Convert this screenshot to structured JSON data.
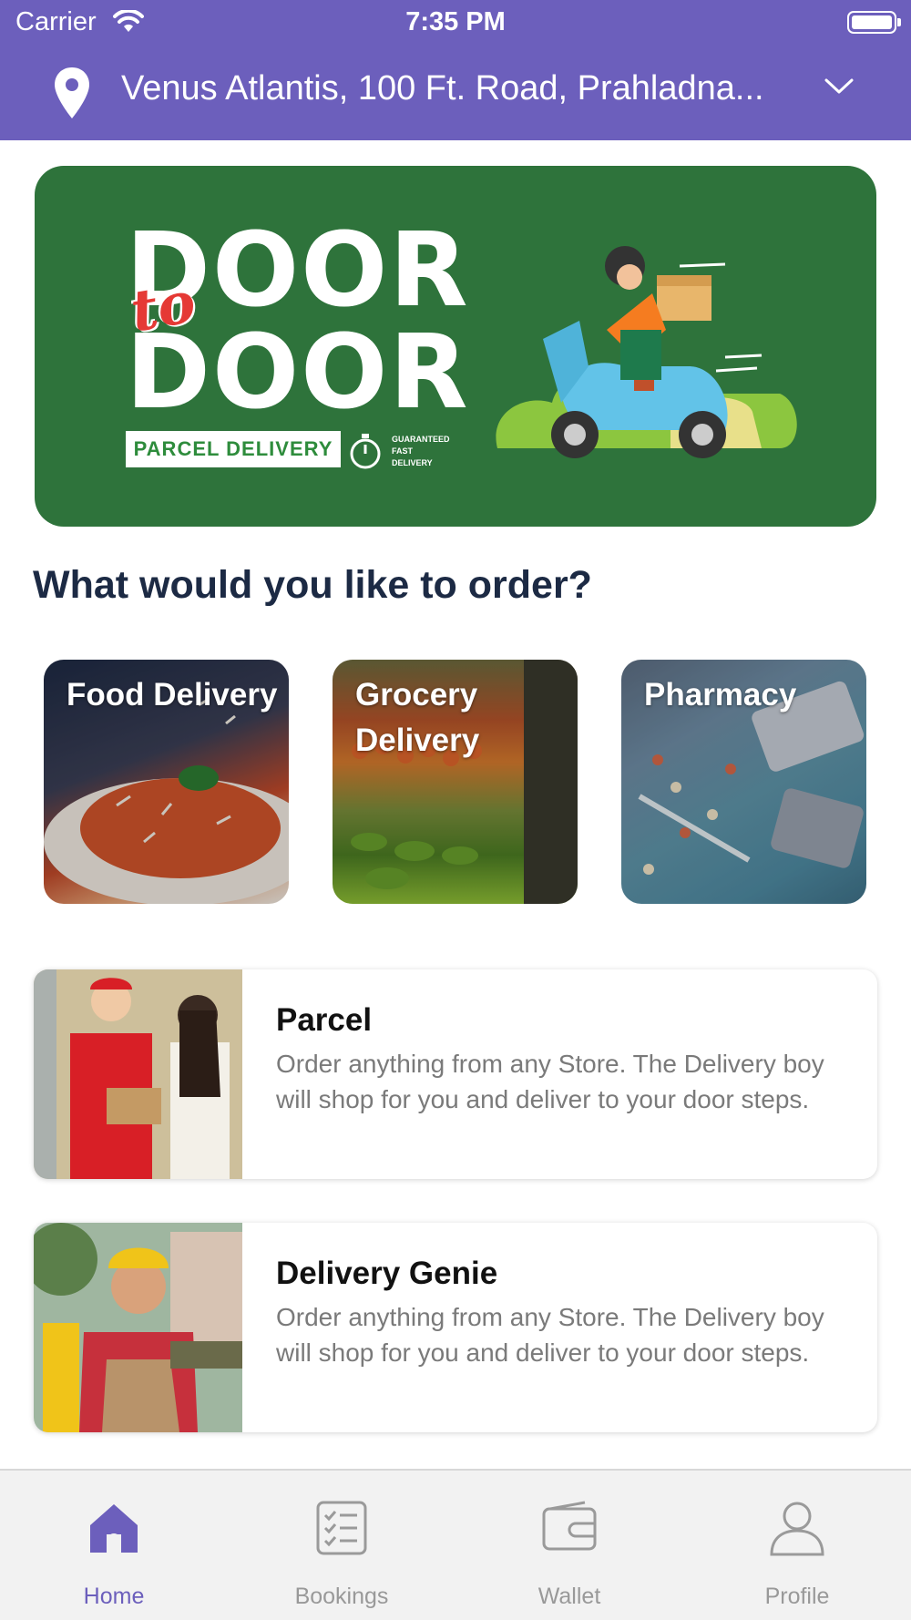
{
  "status_bar": {
    "carrier": "Carrier",
    "time": "7:35 PM"
  },
  "location": {
    "address": "Venus Atlantis, 100 Ft. Road, Prahladna..."
  },
  "banner": {
    "line1": "DOOR",
    "connector": "to",
    "line2": "DOOR",
    "tag": "PARCEL DELIVERY",
    "guarantee_line1": "GUARANTEED",
    "guarantee_line2": "FAST",
    "guarantee_line3": "DELIVERY"
  },
  "section_title": "What would you like to order?",
  "categories": [
    {
      "label": "Food Delivery"
    },
    {
      "label": "Grocery Delivery"
    },
    {
      "label": "Pharmacy"
    }
  ],
  "services": [
    {
      "title": "Parcel",
      "description": "Order anything from any Store. The Delivery boy will shop for you and deliver to your door steps."
    },
    {
      "title": "Delivery Genie",
      "description": "Order anything from any Store. The Delivery boy will shop for you and deliver to your door steps."
    }
  ],
  "tabs": [
    {
      "label": "Home",
      "icon": "home-icon",
      "active": true
    },
    {
      "label": "Bookings",
      "icon": "checklist-icon",
      "active": false
    },
    {
      "label": "Wallet",
      "icon": "wallet-icon",
      "active": false
    },
    {
      "label": "Profile",
      "icon": "person-icon",
      "active": false
    }
  ],
  "colors": {
    "brand": "#6c5fbc",
    "banner_green": "#2e733b",
    "inactive_tab": "#999999"
  }
}
